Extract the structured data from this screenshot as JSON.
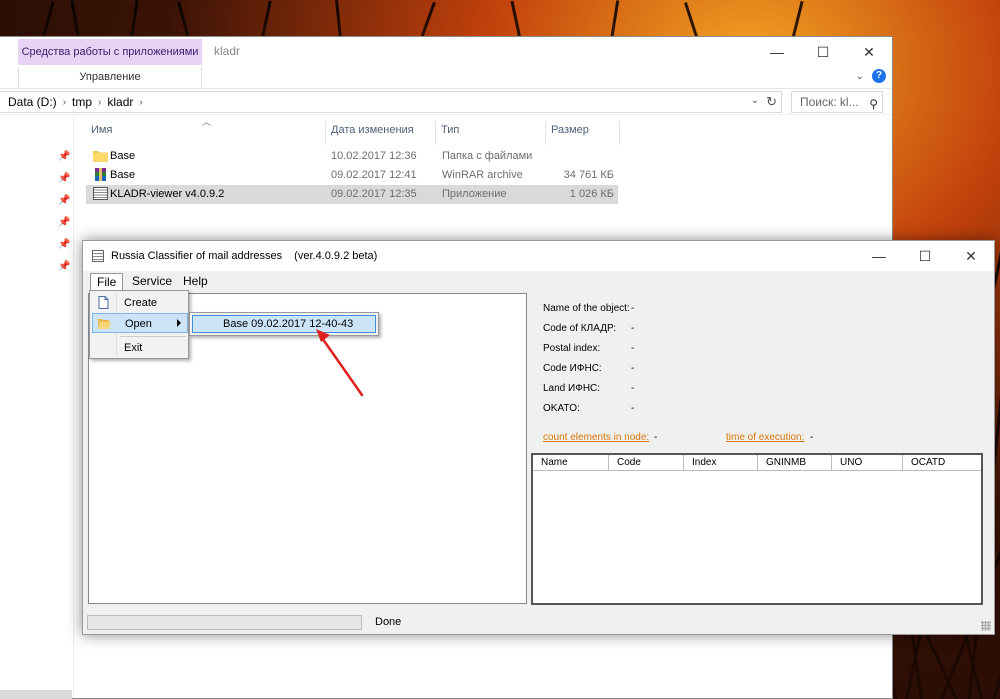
{
  "explorer": {
    "context_tab": "Средства работы с приложениями",
    "title": "kladr",
    "ribbon_tab": "Управление",
    "breadcrumb": [
      "Data (D:)",
      "tmp",
      "kladr"
    ],
    "search_placeholder": "Поиск: kl...",
    "columns": [
      "Имя",
      "Дата изменения",
      "Тип",
      "Размер"
    ],
    "files": [
      {
        "icon": "folder-icon",
        "name": "Base",
        "date": "10.02.2017 12:36",
        "type": "Папка с файлами",
        "size": ""
      },
      {
        "icon": "winrar-icon",
        "name": "Base",
        "date": "09.02.2017 12:41",
        "type": "WinRAR archive",
        "size": "34 761 КБ"
      },
      {
        "icon": "app-icon",
        "name": "KLADR-viewer v4.0.9.2",
        "date": "09.02.2017 12:35",
        "type": "Приложение",
        "size": "1 026 КБ"
      }
    ]
  },
  "app": {
    "title": "Russia Classifier of mail addresses",
    "version": "(ver.4.0.9.2 beta)",
    "menu": [
      "File",
      "Service",
      "Help"
    ],
    "file_menu": {
      "create": "Create",
      "open": "Open",
      "exit": "Exit"
    },
    "open_submenu_item": "Base 09.02.2017 12-40-43",
    "info": [
      {
        "label": "Name of the object:",
        "value": "-"
      },
      {
        "label": "Code of КЛАДР:",
        "value": "-"
      },
      {
        "label": "Postal index:",
        "value": "-"
      },
      {
        "label": "Code ИФНС:",
        "value": "-"
      },
      {
        "label": "Land ИФНС:",
        "value": "-"
      },
      {
        "label": "OKATO:",
        "value": "-"
      }
    ],
    "count_link": "count elements in node:",
    "count_value": "-",
    "time_link": "time of execution:",
    "time_value": "-",
    "grid_columns": [
      "Name",
      "Code",
      "Index",
      "GNINMB",
      "UNO",
      "OCATD"
    ],
    "status": "Done"
  },
  "colors": {
    "context_tab": "#e7d4f5",
    "link": "#d97706",
    "highlight": "#cce4f7",
    "annotation_arrow": "#e02020"
  }
}
